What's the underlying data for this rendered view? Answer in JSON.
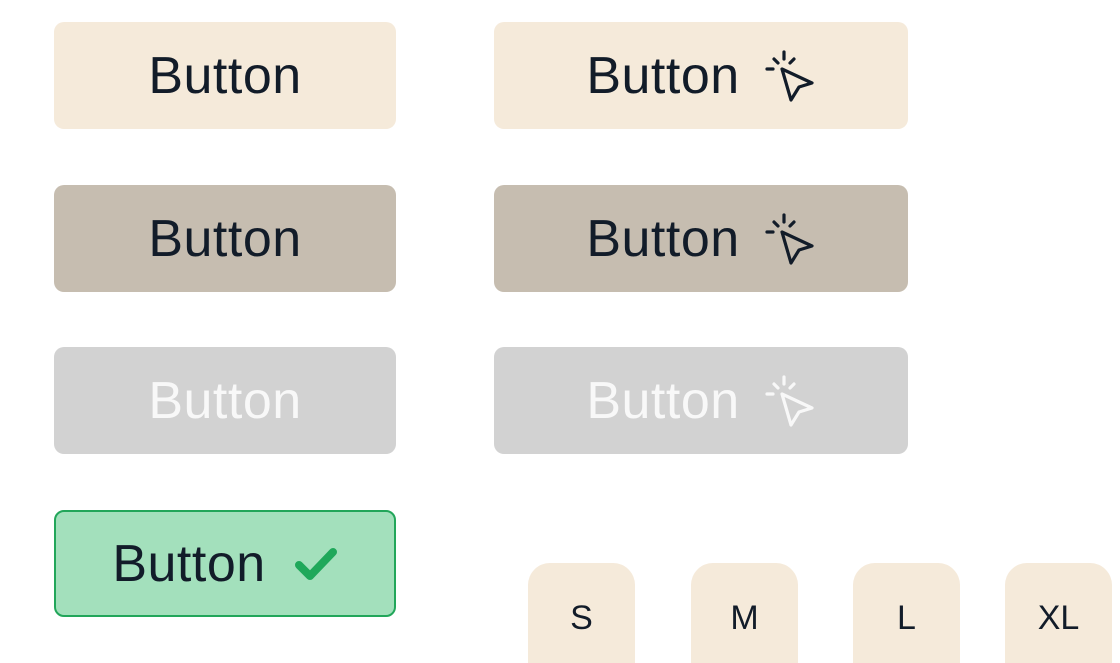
{
  "buttons": {
    "default_label": "Button",
    "default_cursor_label": "Button",
    "active_label": "Button",
    "active_cursor_label": "Button",
    "disabled_label": "Button",
    "disabled_cursor_label": "Button",
    "success_label": "Button"
  },
  "icons": {
    "cursor_click": "cursor-click-icon",
    "check": "check-icon"
  },
  "sizes": [
    "S",
    "M",
    "L",
    "XL"
  ],
  "colors": {
    "default_bg": "#f5eada",
    "active_bg": "#c6bdb0",
    "disabled_bg": "#d2d2d2",
    "success_bg": "#a3e0bc",
    "success_border": "#22a65a",
    "success_check": "#1fa85a",
    "text": "#121c29"
  }
}
